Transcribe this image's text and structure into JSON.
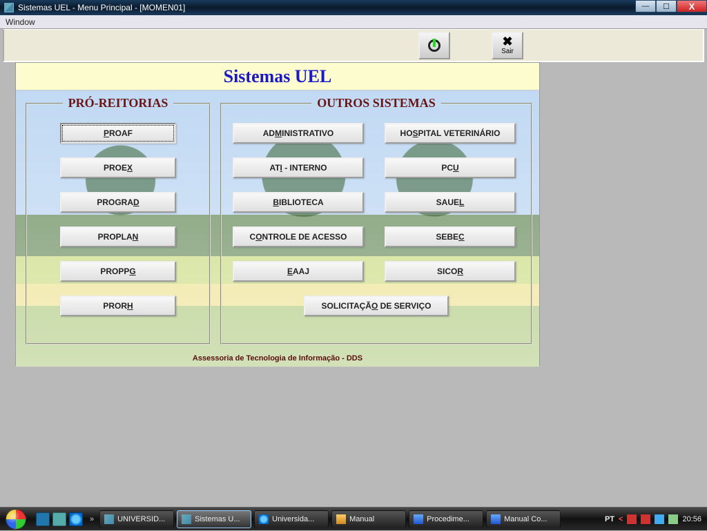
{
  "titlebar": {
    "text": "Sistemas UEL - Menu Principal - [MOMEN01]"
  },
  "menubar": {
    "window": "Window"
  },
  "toolbar": {
    "exit_label": "Sair"
  },
  "panel": {
    "title": "Sistemas UEL",
    "group_left_title": "PRÓ-REITORIAS",
    "group_right_title": "OUTROS SISTEMAS",
    "footer": "Assessoria de Tecnologia de Informação - DDS"
  },
  "pro_reitorias": {
    "proaf": {
      "pre": "",
      "mn": "P",
      "post": "ROAF"
    },
    "proex": {
      "pre": "PROE",
      "mn": "X",
      "post": ""
    },
    "prograd": {
      "pre": "PROGRA",
      "mn": "D",
      "post": ""
    },
    "proplan": {
      "pre": "PROPLA",
      "mn": "N",
      "post": ""
    },
    "proppg": {
      "pre": "PROPP",
      "mn": "G",
      "post": ""
    },
    "prorh": {
      "pre": "PROR",
      "mn": "H",
      "post": ""
    }
  },
  "outros": {
    "administrativo": {
      "pre": "AD",
      "mn": "M",
      "post": "INISTRATIVO"
    },
    "hospital_vet": {
      "pre": "HO",
      "mn": "S",
      "post": "PITAL VETERINÁRIO"
    },
    "ati_interno": {
      "pre": "AT",
      "mn": "I",
      "post": " - INTERNO"
    },
    "pcu": {
      "pre": "PC",
      "mn": "U",
      "post": ""
    },
    "biblioteca": {
      "pre": "",
      "mn": "B",
      "post": "IBLIOTECA"
    },
    "sauel": {
      "pre": "SAUE",
      "mn": "L",
      "post": ""
    },
    "controle_acesso": {
      "pre": "C",
      "mn": "O",
      "post": "NTROLE DE ACESSO"
    },
    "sebec": {
      "pre": "SEBE",
      "mn": "C",
      "post": ""
    },
    "eaaj": {
      "pre": "",
      "mn": "E",
      "post": "AAJ"
    },
    "sicor": {
      "pre": "SICO",
      "mn": "R",
      "post": ""
    },
    "solicitacao": {
      "pre": "SOLICITAÇÃ",
      "mn": "O",
      "post": " DE SERVIÇO"
    }
  },
  "taskbar": {
    "items": [
      {
        "label": "UNIVERSID...",
        "icon": "app"
      },
      {
        "label": "Sistemas U...",
        "icon": "app"
      },
      {
        "label": "Universida...",
        "icon": "ie"
      },
      {
        "label": "Manual",
        "icon": "folder"
      },
      {
        "label": "Procedime...",
        "icon": "word"
      },
      {
        "label": "Manual Co...",
        "icon": "word"
      }
    ],
    "lang": "PT",
    "clock": "20:56"
  }
}
